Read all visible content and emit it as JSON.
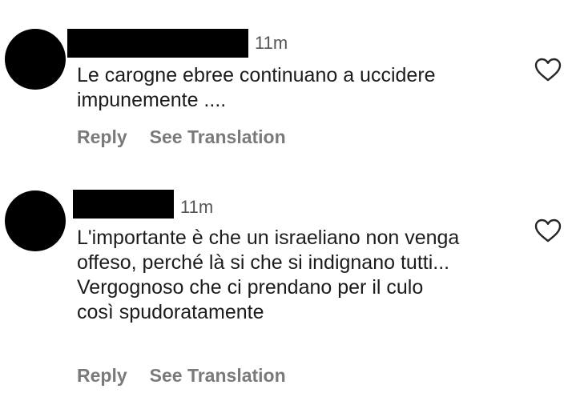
{
  "comments": [
    {
      "timestamp": "11m",
      "text": "Le carogne ebree continuano a uccidere impunemente ....",
      "reply_label": "Reply",
      "translate_label": "See Translation"
    },
    {
      "timestamp": "11m",
      "text": "L'importante è che un israeliano non venga offeso, perché là si che si indignano tutti... Vergognoso che ci prendano per il culo così spudoratamente",
      "reply_label": "Reply",
      "translate_label": "See Translation"
    }
  ],
  "icons": {
    "like": "heart-outline-icon",
    "avatar": "redacted-avatar"
  },
  "colors": {
    "text": "#1c1c1c",
    "muted": "#7a7a7a",
    "redaction": "#000000"
  }
}
